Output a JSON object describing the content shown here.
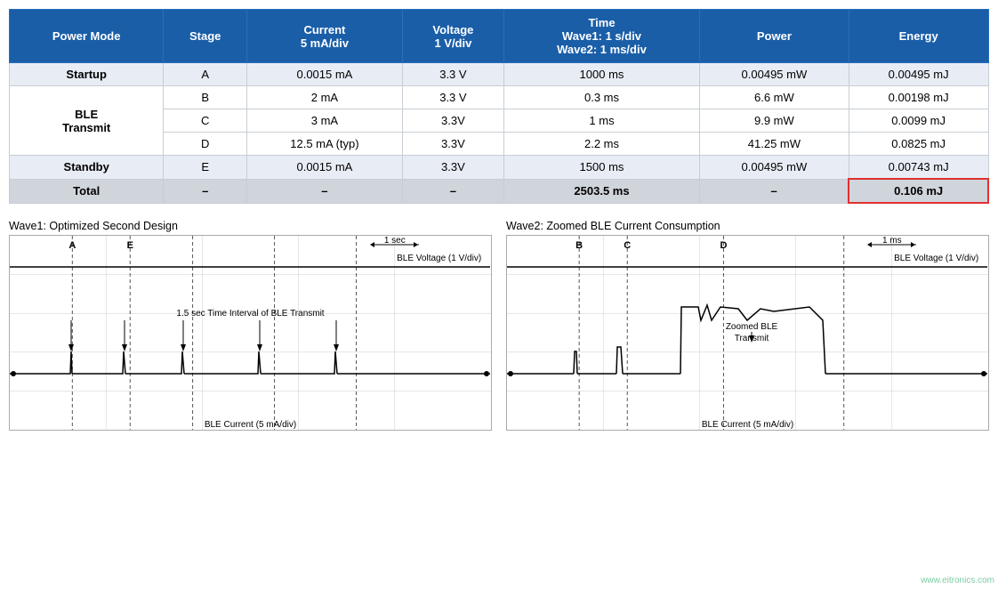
{
  "table": {
    "headers": [
      "Power Mode",
      "Stage",
      "Current\n5 mA/div",
      "Voltage\n1 V/div",
      "Time\nWave1: 1 s/div\nWave2: 1 ms/div",
      "Power",
      "Energy"
    ],
    "rows": [
      {
        "mode": "Startup",
        "stage": "A",
        "current": "0.0015 mA",
        "voltage": "3.3 V",
        "time": "1000 ms",
        "power": "0.00495 mW",
        "energy": "0.00495 mJ",
        "class": "row-startup",
        "modeSpan": 1
      },
      {
        "mode": "BLE\nTransmit",
        "stage": "B",
        "current": "2 mA",
        "voltage": "3.3 V",
        "time": "0.3 ms",
        "power": "6.6 mW",
        "energy": "0.00198 mJ",
        "class": "row-ble-b",
        "modeSpan": 3
      },
      {
        "mode": "",
        "stage": "C",
        "current": "3 mA",
        "voltage": "3.3V",
        "time": "1 ms",
        "power": "9.9 mW",
        "energy": "0.0099 mJ",
        "class": "row-ble-c",
        "modeSpan": 0
      },
      {
        "mode": "",
        "stage": "D",
        "current": "12.5 mA (typ)",
        "voltage": "3.3V",
        "time": "2.2 ms",
        "power": "41.25 mW",
        "energy": "0.0825 mJ",
        "class": "row-ble-d",
        "modeSpan": 0
      },
      {
        "mode": "Standby",
        "stage": "E",
        "current": "0.0015 mA",
        "voltage": "3.3V",
        "time": "1500 ms",
        "power": "0.00495 mW",
        "energy": "0.00743 mJ",
        "class": "row-standby",
        "modeSpan": 1
      },
      {
        "mode": "Total",
        "stage": "–",
        "current": "–",
        "voltage": "–",
        "time": "2503.5 ms",
        "power": "–",
        "energy": "0.106 mJ",
        "class": "row-total",
        "modeSpan": 1,
        "isTotal": true
      }
    ]
  },
  "wave1": {
    "title": "Wave1: Optimized Second Design",
    "labels": {
      "voltage": "BLE Voltage (1 V/div)",
      "current": "BLE Current (5 mA/div)",
      "timeScale": "1 sec",
      "annotation": "1.5 sec Time Interval of BLE Transmit"
    },
    "markers": [
      "A",
      "E"
    ],
    "markerPositions": [
      0.13,
      0.25
    ]
  },
  "wave2": {
    "title": "Wave2: Zoomed BLE Current Consumption",
    "labels": {
      "voltage": "BLE Voltage (1 V/div)",
      "current": "BLE Current (5 mA/div)",
      "timeScale": "1 ms",
      "annotation": "Zoomed BLE\nTransmit"
    },
    "markers": [
      "B",
      "C",
      "D"
    ],
    "markerPositions": [
      0.15,
      0.25,
      0.42
    ]
  },
  "watermark": "www.eitronics.com"
}
